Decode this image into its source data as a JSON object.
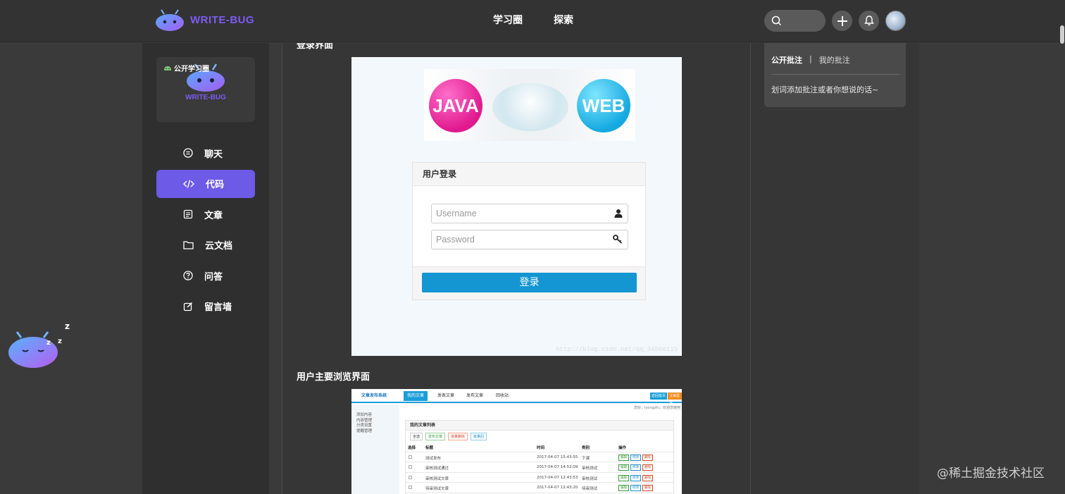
{
  "brand": {
    "name": "WRITE-BUG"
  },
  "nav": {
    "items": [
      "学习圈",
      "探索"
    ]
  },
  "sidebar": {
    "circle_tag": "公开学习圈",
    "circle_logo_text": "WRITE-BUG",
    "items": [
      {
        "label": "聊天",
        "icon": "chat-icon",
        "active": false
      },
      {
        "label": "代码",
        "icon": "code-icon",
        "active": true
      },
      {
        "label": "文章",
        "icon": "document-icon",
        "active": false
      },
      {
        "label": "云文档",
        "icon": "folder-icon",
        "active": false
      },
      {
        "label": "问答",
        "icon": "question-icon",
        "active": false
      },
      {
        "label": "留言墙",
        "icon": "edit-icon",
        "active": false
      }
    ]
  },
  "main": {
    "section1_title": "登录界面",
    "login": {
      "banner_left": "JAVA",
      "banner_right": "WEB",
      "title": "用户登录",
      "username_placeholder": "Username",
      "password_placeholder": "Password",
      "submit": "登录",
      "watermark": "http://blog.csdn.net/qq_34566115"
    },
    "section2_title": "用户主要浏览界面",
    "preview": {
      "brand": "文章发布系统",
      "tabs": [
        "我的文章",
        "发表文章",
        "发布文章",
        "回收站"
      ],
      "right_buttons": [
        "返回首页",
        "注销登录"
      ],
      "user_line": "您好，lyongzhi，欢迎您使用",
      "left_menu": [
        "添加内容",
        "内容管理",
        "分类设置",
        "提醒管理"
      ],
      "panel_title": "我的文章列表",
      "filters": [
        "全选",
        "发布文章",
        "批量删除",
        "批量回"
      ],
      "columns": [
        "选择",
        "标题",
        "时间",
        "类别",
        "操作"
      ],
      "rows": [
        {
          "title": "测试发布",
          "time": "2017-04-07 15:43:55",
          "category": "下课"
        },
        {
          "title": "审核测试通过",
          "time": "2017-04-07 14:52:09",
          "category": "审核测试"
        },
        {
          "title": "审核测试文章",
          "time": "2017-04-07 12:43:53",
          "category": "审核测试"
        },
        {
          "title": "待审测试文章",
          "time": "2017-04-07 12:43:20",
          "category": "待审测试"
        }
      ],
      "actions": [
        "编辑",
        "修改",
        "删除"
      ]
    }
  },
  "annotations": {
    "tab_public": "公开批注",
    "separator": "|",
    "tab_mine": "我的批注",
    "hint": "划词添加批注或者你想说的话~"
  },
  "footer_watermark": "@稀土掘金技术社区",
  "colors": {
    "accent": "#6d5ae6",
    "brand": "#7b5cf0",
    "login_button": "#1496d2"
  }
}
